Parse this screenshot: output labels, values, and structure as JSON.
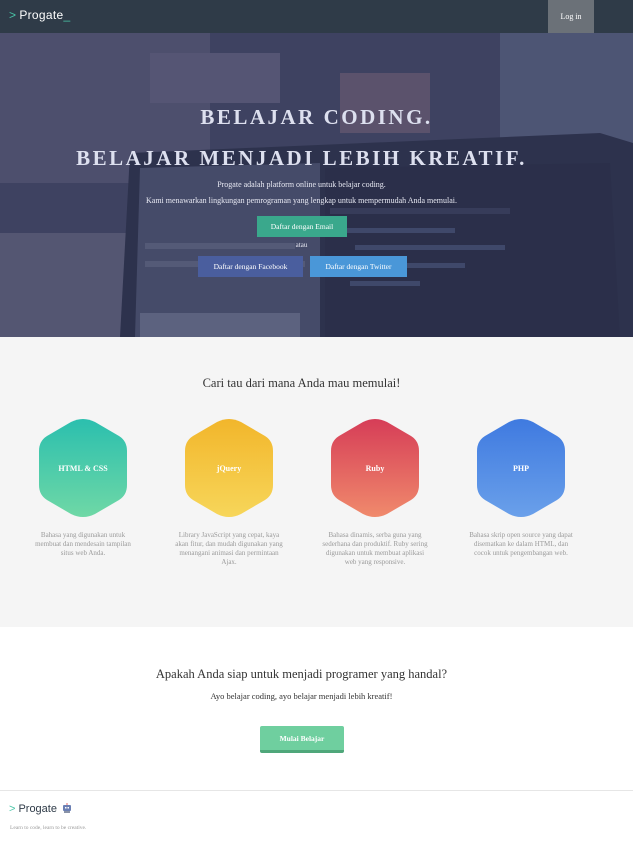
{
  "navbar": {
    "logo_prefix": ">",
    "logo_text": "Progate",
    "logo_suffix": "_",
    "login_label": "Log in"
  },
  "hero": {
    "title_line1": "BELAJAR CODING.",
    "title_line2": "BELAJAR MENJADI LEBIH KREATIF.",
    "subtitle_line1": "Progate adalah platform online untuk belajar coding.",
    "subtitle_line2": "Kami menawarkan lingkungan pemrograman yang lengkap untuk mempermudah Anda memulai.",
    "email_button": "Daftar dengan Email",
    "or_text": "atau",
    "facebook_button": "Daftar dengan Facebook",
    "twitter_button": "Daftar dengan Twitter"
  },
  "courses": {
    "title": "Cari tau dari mana Anda mau memulai!",
    "items": [
      {
        "name": "HTML & CSS",
        "description": "Bahasa yang digunakan untuk membuat dan mendesain tampilan situs web Anda.",
        "color_top": "#2bbfae",
        "color_bottom": "#6fd8a6"
      },
      {
        "name": "jQuery",
        "description": "Library JavaScript yang cepat, kaya akan fitur, dan mudah digunakan yang menangani animasi dan permintaan Ajax.",
        "color_top": "#f2b62b",
        "color_bottom": "#f7d65a"
      },
      {
        "name": "Ruby",
        "description": "Bahasa dinamis, serba guna yang sederhana dan produktif. Ruby sering digunakan untuk membuat aplikasi web yang responsive.",
        "color_top": "#d63d57",
        "color_bottom": "#f08a6c"
      },
      {
        "name": "PHP",
        "description": "Bahasa skrip open source yang dapat disematkan ke dalam HTML, dan cocok untuk pengembangan web.",
        "color_top": "#3f7ae0",
        "color_bottom": "#6aa0ea"
      }
    ]
  },
  "cta": {
    "title": "Apakah Anda siap untuk menjadi programer yang handal?",
    "subtitle": "Ayo belajar coding, ayo belajar menjadi lebih kreatif!",
    "button": "Mulai Belajar"
  },
  "footer": {
    "logo_prefix": ">",
    "logo_text": "Progate",
    "tagline": "Learn to code, learn to be creative."
  }
}
